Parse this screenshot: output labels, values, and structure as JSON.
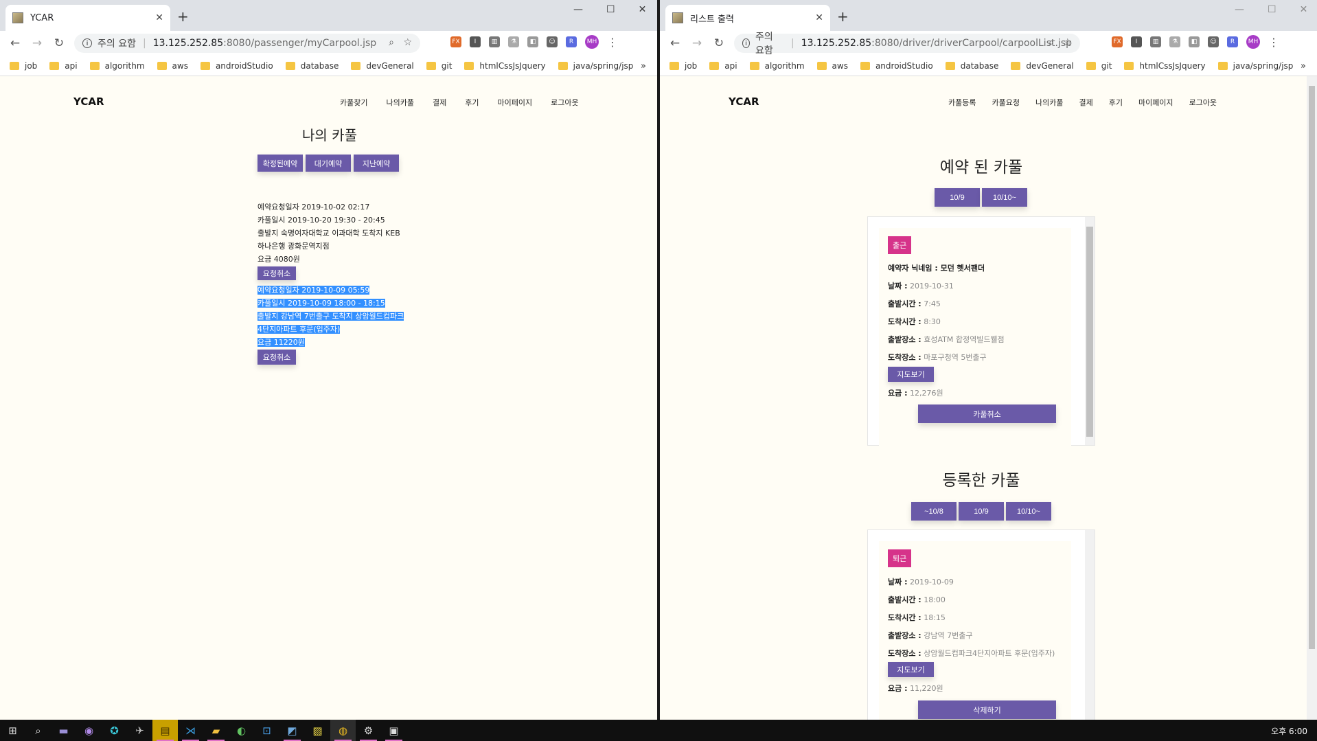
{
  "left_window": {
    "tab_title": "YCAR",
    "url_warning": "주의 요함",
    "url_host": "13.125.252.85",
    "url_path": ":8080/passenger/myCarpool.jsp",
    "bookmarks": [
      "job",
      "api",
      "algorithm",
      "aws",
      "androidStudio",
      "database",
      "devGeneral",
      "git",
      "htmlCssJsJquery",
      "java/spring/jsp"
    ],
    "bookmarks_more": "»",
    "avatar": "MH",
    "site": {
      "logo": "YCAR",
      "nav": [
        "카풀찾기",
        "나의카풀",
        "결제",
        "후기",
        "마이페이지",
        "로그아웃"
      ],
      "title": "나의 카풀",
      "tabs": [
        "확정된예약",
        "대기예약",
        "지난예약"
      ],
      "reservations": [
        {
          "lines": [
            "예약요청일자 2019-10-02 02:17",
            "카풀일시 2019-10-20 19:30 - 20:45",
            "출발지 숙명여자대학교 이과대학 도착지 KEB",
            "하나은행 광화문역지점",
            "요금 4080원"
          ],
          "cancel": "요청취소"
        },
        {
          "lines": [
            "예약요청일자 2019-10-09 05:59",
            "카풀일시 2019-10-09 18:00 - 18:15",
            "출발지 강남역 7번출구 도착지 상암월드컵파크",
            "4단지아파트 후문(입주자)",
            "요금 11220원"
          ],
          "cancel": "요청취소"
        }
      ]
    }
  },
  "right_window": {
    "tab_title": "리스트 출력",
    "url_warning": "주의 요함",
    "url_host": "13.125.252.85",
    "url_path": ":8080/driver/driverCarpool/carpoolList.jsp",
    "bookmarks": [
      "job",
      "api",
      "algorithm",
      "aws",
      "androidStudio",
      "database",
      "devGeneral",
      "git",
      "htmlCssJsJquery",
      "java/spring/jsp"
    ],
    "bookmarks_more": "»",
    "avatar": "MH",
    "site": {
      "logo": "YCAR",
      "nav": [
        "카풀등록",
        "카풀요청",
        "나의카풀",
        "결제",
        "후기",
        "마이페이지",
        "로그아웃"
      ],
      "booked_title": "예약 된 카풀",
      "booked_dates": [
        "10/9",
        "10/10~"
      ],
      "booked_card": {
        "badge": "출근",
        "reserver": "예약자 닉네임 : 모던 헷서팬더",
        "fields": [
          {
            "label": "날짜 :",
            "value": "2019-10-31"
          },
          {
            "label": "출발시간 :",
            "value": "7:45"
          },
          {
            "label": "도착시간 :",
            "value": "8:30"
          },
          {
            "label": "출발장소 :",
            "value": "효성ATM 합정역빌드웰점"
          },
          {
            "label": "도착장소 :",
            "value": "마포구청역 5번출구"
          }
        ],
        "map_button": "지도보기",
        "fee_label": "요금 :",
        "fee_value": "12,276원",
        "action": "카풀취소"
      },
      "registered_title": "등록한 카풀",
      "registered_dates": [
        "~10/8",
        "10/9",
        "10/10~"
      ],
      "registered_card": {
        "badge": "퇴근",
        "fields": [
          {
            "label": "날짜 :",
            "value": "2019-10-09"
          },
          {
            "label": "출발시간 :",
            "value": "18:00"
          },
          {
            "label": "도착시간 :",
            "value": "18:15"
          },
          {
            "label": "출발장소 :",
            "value": "강남역 7번출구"
          },
          {
            "label": "도착장소 :",
            "value": "상암월드컵파크4단지아파트 후문(입주자)"
          }
        ],
        "map_button": "지도보기",
        "fee_label": "요금 :",
        "fee_value": "11,220원",
        "action": "삭제하기"
      }
    }
  },
  "taskbar": {
    "clock": "오후 6:00",
    "icons": [
      "windows-start-icon",
      "search-icon",
      "app-icon",
      "app-icon",
      "app-icon",
      "app-icon",
      "kakaotalk-icon",
      "vscode-icon",
      "file-explorer-icon",
      "app-icon",
      "app-icon",
      "app-icon",
      "sticky-notes-icon",
      "chrome-icon",
      "settings-icon",
      "photos-icon"
    ]
  }
}
